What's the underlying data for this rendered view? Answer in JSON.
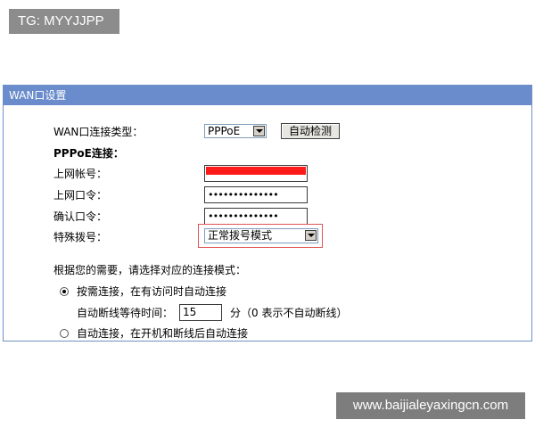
{
  "watermarks": {
    "top": "TG: MYYJJPP",
    "bottom": "www.baijialeyaxingcn.com"
  },
  "panel": {
    "title": "WAN口设置"
  },
  "form": {
    "wan_type_label": "WAN口连接类型：",
    "wan_type_value": "PPPoE",
    "auto_detect_label": "自动检测",
    "pppoe_heading": "PPPoE连接：",
    "username_label": "上网帐号：",
    "username_value": "",
    "password_label": "上网口令：",
    "password_value": "••••••••••••••",
    "confirm_label": "确认口令：",
    "confirm_value": "••••••••••••••",
    "special_dial_label": "特殊拨号：",
    "special_dial_value": "正常拨号模式"
  },
  "connection_mode": {
    "prompt": "根据您的需要，请选择对应的连接模式：",
    "option1_label": "按需连接，在有访问时自动连接",
    "option1_selected": true,
    "idle_label": "自动断线等待时间：",
    "idle_value": "15",
    "idle_unit": "分（0 表示不自动断线）",
    "option2_label": "自动连接，在开机和断线后自动连接",
    "option2_selected": false
  },
  "colors": {
    "titlebar": "#6a8ccc",
    "highlight_border": "#e05555",
    "redaction": "#ff1a1a"
  }
}
